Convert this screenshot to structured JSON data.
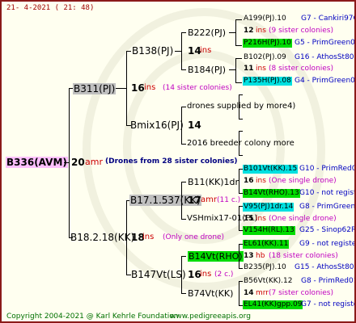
{
  "header": {
    "date": "21- 4-2021 ( 21: 48)"
  },
  "footer": {
    "copyright": "Copyright 2004-2021 @ Karl Kehrle Foundation",
    "website": "www.pedigreeapis.org"
  },
  "colors": {
    "frame": "#8b1a1a",
    "background": "#fffff0",
    "queen_highlight": "#ffc0ff",
    "sister_highlight": "#c0c0c0",
    "green_highlight": "#00dc00",
    "cyan_highlight": "#00e0e0"
  },
  "root": {
    "name": "B336(AVM)",
    "year": "20",
    "code": "amr",
    "note": "(Drones from 28 sister colonies)"
  },
  "gen1": [
    {
      "name": "B311(PJ)",
      "year": "16",
      "code": "ins",
      "note": "(14 sister colonies)"
    },
    {
      "name": "B18.2.18(KK)",
      "year": "18",
      "code": "ins",
      "note": "(Only one drone)"
    }
  ],
  "gen2": [
    {
      "name": "B138(PJ)",
      "year": "14",
      "code": "ins"
    },
    {
      "name": "Bmix16(PJ)",
      "year": "14"
    },
    {
      "name": "B17.1.537(KK)",
      "year": "17",
      "code": "amr",
      "note": "(11 c.)"
    },
    {
      "name": "B147Vt(LS)",
      "year": "16",
      "code": "ins",
      "note": "(2 c.)"
    }
  ],
  "gen3": [
    {
      "name": "B222(PJ)"
    },
    {
      "name": "B184(PJ)"
    },
    {
      "name": "drones supplied by more4)"
    },
    {
      "name": "2016 breeder colony more"
    },
    {
      "name": "B11(KK)1dr"
    },
    {
      "name": "VSHmix17-01(FL)"
    },
    {
      "name": "B14Vt(RHO)"
    },
    {
      "name": "B74Vt(KK)"
    }
  ],
  "gen4": [
    {
      "name": "A199(PJ).10",
      "right": "G7 - Cankiri97Q"
    },
    {
      "year": "12",
      "code": "ins",
      "note": "(9 sister colonies)"
    },
    {
      "name": "P216H(PJ).10",
      "right": "G5 - PrimGreen00"
    },
    {
      "name": "B102(PJ).09",
      "right": "G16 - AthosSt80R"
    },
    {
      "year": "11",
      "code": "ins",
      "note": "(8 sister colonies)"
    },
    {
      "name": "P135H(PJ).08",
      "right": "G4 - PrimGreen00"
    },
    {
      "name": "B101Vt(KK).15",
      "right": "G10 - PrimRed01"
    },
    {
      "year": "16",
      "code": "ins",
      "note": "(One single drone)"
    },
    {
      "name": "B14Vt(RHO).13",
      "right": "G10 - not registe"
    },
    {
      "name": "V95(PJ)1dr.14",
      "right": "G8 - PrimGreen00"
    },
    {
      "year": "15",
      "code": "ins",
      "note": "(One single drone)"
    },
    {
      "name": "V154H(RL).13",
      "right": "G25 - Sinop62R"
    },
    {
      "name": "EL61(KK).11",
      "right": "G9 - not registe"
    },
    {
      "year": "13",
      "code": "hb",
      "note": "(18 sister colonies)"
    },
    {
      "name": "B235(PJ).10",
      "right": "G15 - AthosSt80R"
    },
    {
      "name": "B56Vt(KK).12",
      "right": "G8 - PrimRed01"
    },
    {
      "year": "14",
      "code": "mrr",
      "note": "(7 sister colonies)"
    },
    {
      "name": "EL41(KK)gpp.09",
      "right": "G7 - not registe"
    }
  ]
}
